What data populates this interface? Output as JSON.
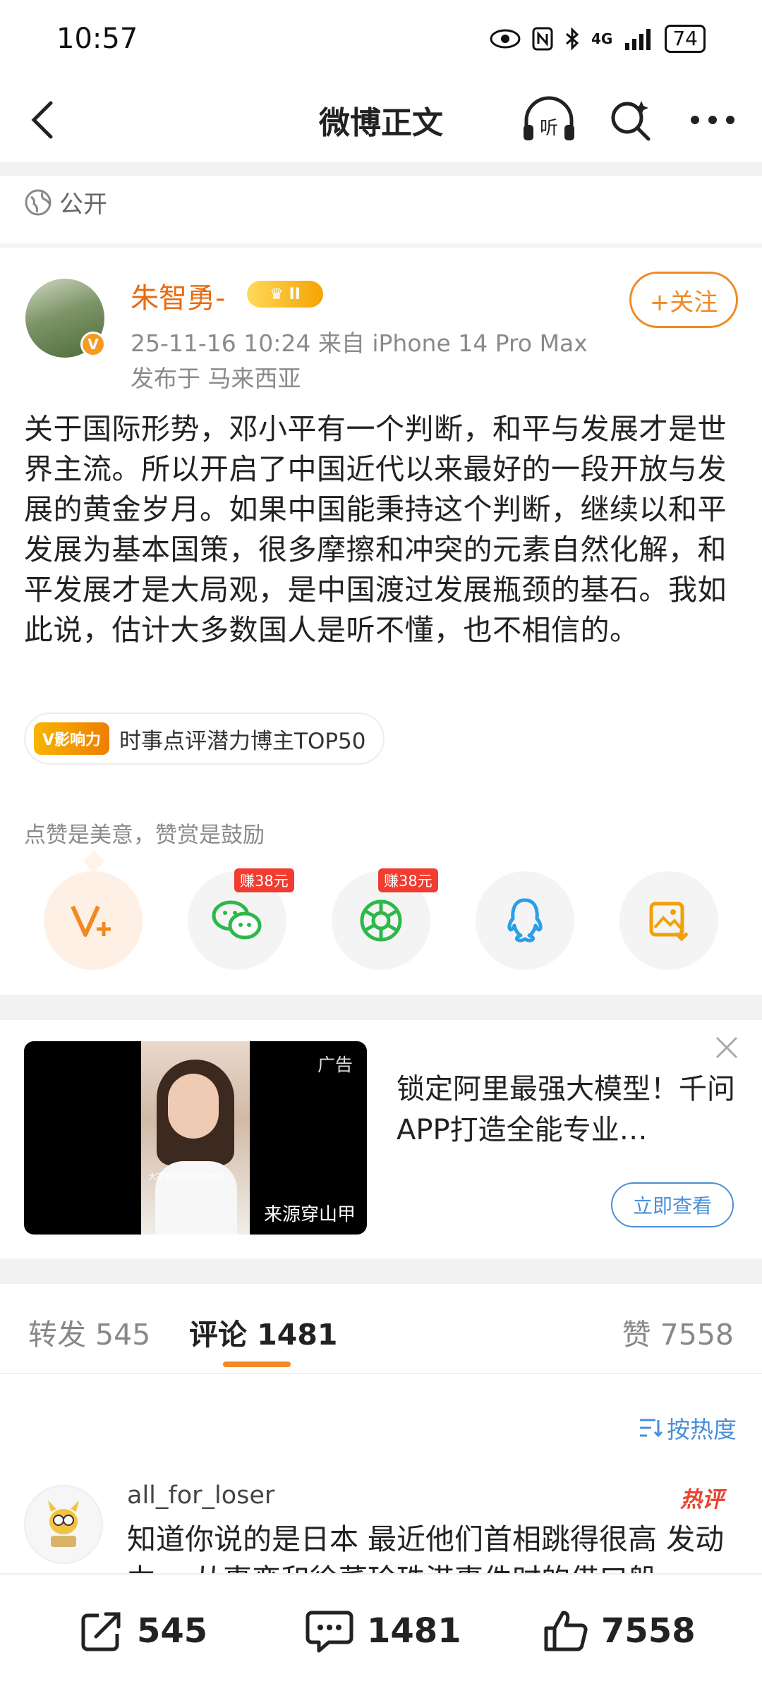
{
  "status_bar": {
    "time": "10:57",
    "network": "4G",
    "battery": "74"
  },
  "nav": {
    "title": "微博正文",
    "listen_label": "听"
  },
  "post": {
    "visibility": "公开",
    "author": {
      "name": "朱智勇-",
      "level": "II",
      "follow_label": "+关注"
    },
    "meta": "25-11-16 10:24  来自 iPhone 14 Pro Max",
    "location": "发布于 马来西亚",
    "text": "关于国际形势，邓小平有一个判断，和平与发展才是世界主流。所以开启了中国近代以来最好的一段开放与发展的黄金岁月。如果中国能秉持这个判断，继续以和平发展为基本国策，很多摩擦和冲突的元素自然化解，和平发展才是大局观，是中国渡过发展瓶颈的基石。我如此说，估计大多数国人是听不懂，也不相信的。",
    "influence": {
      "logo": "V影响力",
      "label": "时事点评潜力博主TOP50"
    },
    "reward_text": "点赞是美意，赞赏是鼓励",
    "share": [
      {
        "name": "vplus",
        "earn": ""
      },
      {
        "name": "wechat",
        "earn": "赚38元"
      },
      {
        "name": "moments",
        "earn": "赚38元"
      },
      {
        "name": "qq",
        "earn": ""
      },
      {
        "name": "save-image",
        "earn": ""
      }
    ]
  },
  "ad": {
    "label": "广告",
    "source": "来源穿山甲",
    "caption": "大家都好奇的是什么",
    "title": "锁定阿里最强大模型！千问APP打造全能专业…",
    "button": "立即查看"
  },
  "tabs": {
    "repost": "转发 545",
    "comment": "评论 1481",
    "like": "赞 7558"
  },
  "sort_label": "按热度",
  "comment": {
    "user": "all_for_loser",
    "hot": "热评",
    "text": "知道你说的是日本 最近他们首相跳得很高 发动力… 从事变和徐蕃珍珠港事件时的借口般"
  },
  "bottom": {
    "repost": "545",
    "comment": "1481",
    "like": "7558"
  },
  "colors": {
    "accent": "#f08a24",
    "link": "#4a8fd8",
    "hot": "#e8452f"
  }
}
